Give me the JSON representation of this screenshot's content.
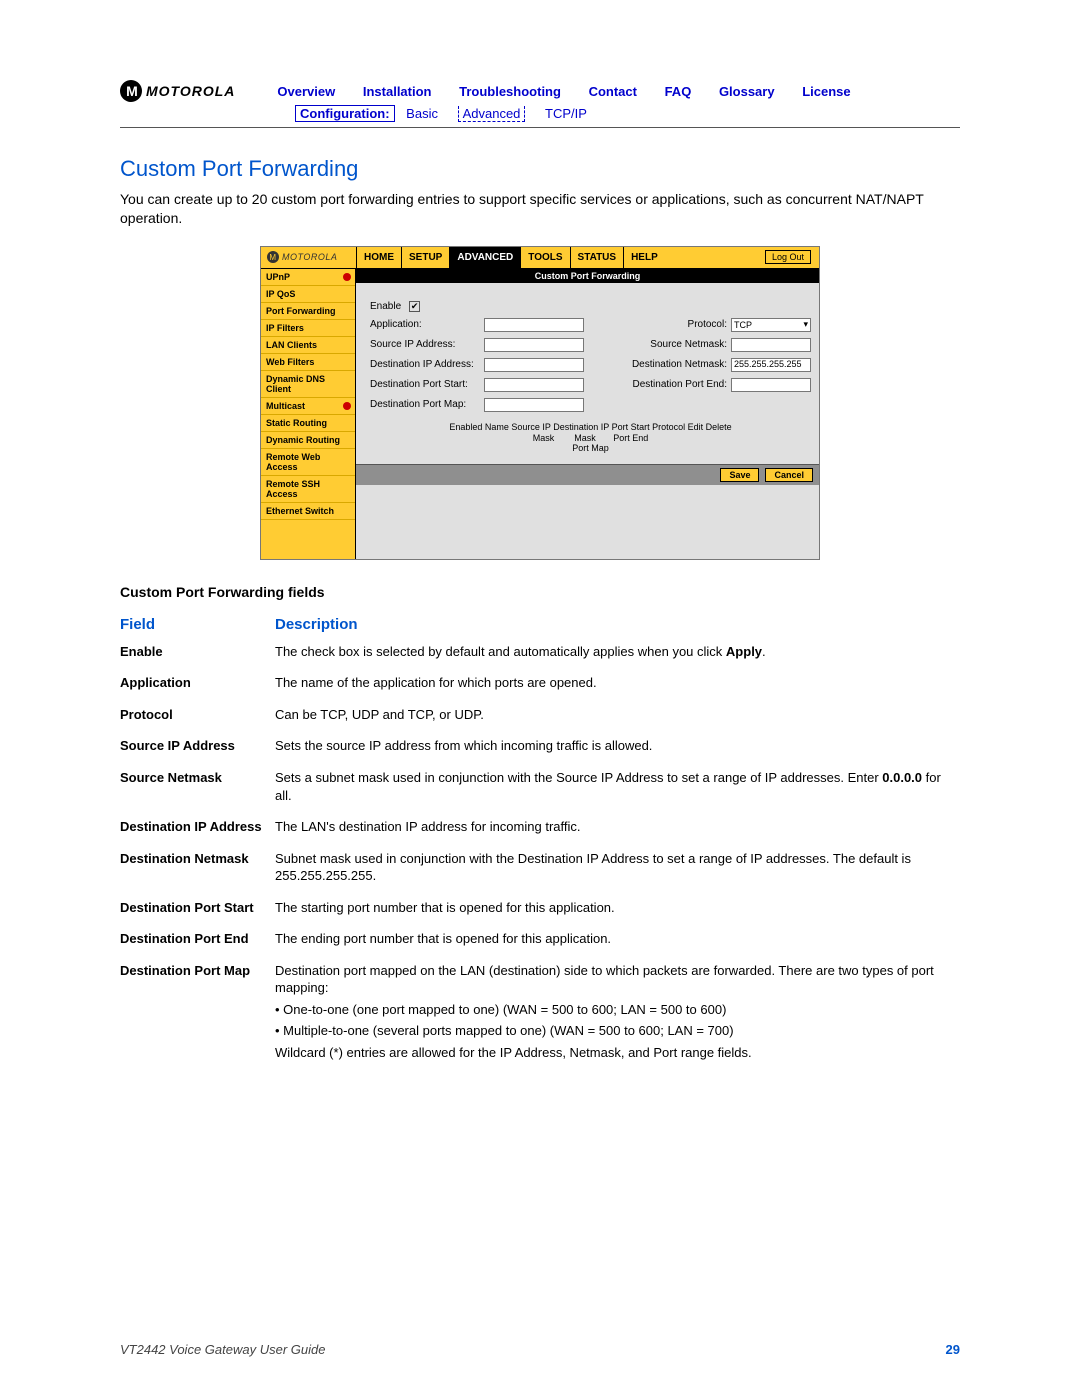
{
  "brand": "MOTOROLA",
  "top_nav": [
    "Overview",
    "Installation",
    "Troubleshooting",
    "Contact",
    "FAQ",
    "Glossary",
    "License"
  ],
  "sub_nav": {
    "label": "Configuration:",
    "items": [
      "Basic",
      "Advanced",
      "TCP/IP"
    ]
  },
  "section_title": "Custom Port Forwarding",
  "intro": "You can create up to 20 custom port forwarding entries to support specific services or applications, such as concurrent NAT/NAPT operation.",
  "ui": {
    "brand": "MOTOROLA",
    "tabs": [
      "HOME",
      "SETUP",
      "ADVANCED",
      "TOOLS",
      "STATUS",
      "HELP"
    ],
    "active_tab": "ADVANCED",
    "logout": "Log Out",
    "side_items": [
      "UPnP",
      "IP QoS",
      "Port Forwarding",
      "IP Filters",
      "LAN Clients",
      "Web Filters",
      "Dynamic DNS Client",
      "Multicast",
      "Static Routing",
      "Dynamic Routing",
      "Remote Web Access",
      "Remote SSH Access",
      "Ethernet Switch"
    ],
    "panel_title": "Custom Port Forwarding",
    "form": {
      "enable": "Enable",
      "application": "Application:",
      "protocol_label": "Protocol:",
      "protocol_value": "TCP",
      "src_ip": "Source IP Address:",
      "src_netmask": "Source Netmask:",
      "dst_ip": "Destination IP Address:",
      "dst_netmask_label": "Destination Netmask:",
      "dst_netmask_value": "255.255.255.255",
      "dst_port_start": "Destination Port Start:",
      "dst_port_end": "Destination Port End:",
      "dst_port_map": "Destination Port Map:",
      "table_hdr_line1": "Enabled Name Source IP Destination IP Port Start Protocol Edit Delete",
      "table_hdr_line2": "Mask        Mask       Port End",
      "table_hdr_line3": "Port Map"
    },
    "save": "Save",
    "cancel": "Cancel"
  },
  "fields_title": "Custom Port Forwarding fields",
  "field_hdr": {
    "c1": "Field",
    "c2": "Description"
  },
  "fields": [
    {
      "name": "Enable",
      "desc_pre": "The check box is selected by default and automatically applies when you click ",
      "desc_bold": "Apply",
      "desc_post": "."
    },
    {
      "name": "Application",
      "desc": "The name of the application for which ports are opened."
    },
    {
      "name": "Protocol",
      "desc": "Can be TCP, UDP and TCP, or UDP."
    },
    {
      "name": "Source IP Address",
      "desc": "Sets the source IP address from which incoming traffic is allowed."
    },
    {
      "name": "Source Netmask",
      "desc_pre": "Sets a subnet mask used in conjunction with the Source IP Address to set a range of IP addresses. Enter ",
      "desc_bold": "0.0.0.0",
      "desc_post": " for all."
    },
    {
      "name": "Destination IP Address",
      "desc": "The LAN's destination IP address for incoming traffic."
    },
    {
      "name": "Destination Netmask",
      "desc": "Subnet mask used in conjunction with the Destination IP Address to set a range of IP addresses. The default is 255.255.255.255."
    },
    {
      "name": "Destination Port Start",
      "desc": "The starting port number that is opened for this application."
    },
    {
      "name": "Destination Port End",
      "desc": "The ending port number that is opened for this application."
    },
    {
      "name": "Destination Port Map",
      "lines": [
        "Destination port mapped on the LAN (destination) side to which packets are forwarded. There are two types of port mapping:",
        "• One-to-one (one port mapped to one) (WAN = 500 to 600; LAN = 500 to 600)",
        "• Multiple-to-one (several ports mapped to one) (WAN = 500 to 600; LAN = 700)",
        "Wildcard (*) entries are allowed for the IP Address, Netmask, and Port range fields."
      ]
    }
  ],
  "footer": {
    "doc": "VT2442 Voice Gateway User Guide",
    "page": "29"
  }
}
